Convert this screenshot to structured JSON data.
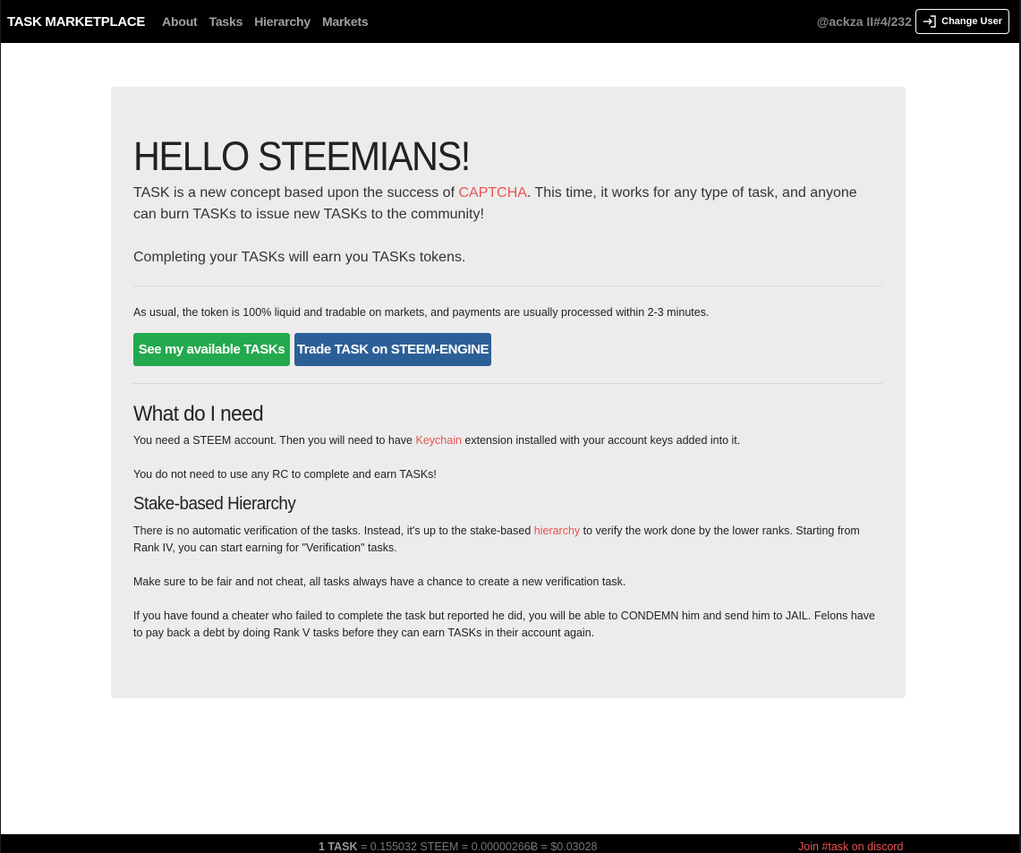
{
  "navbar": {
    "brand": "TASK MARKETPLACE",
    "links": [
      "About",
      "Tasks",
      "Hierarchy",
      "Markets"
    ],
    "user": "@ackza II#4/232",
    "change_user_label": "Change User",
    "change_user_icon": "sign-in-icon"
  },
  "hero": {
    "title": "HELLO STEEMIANS!",
    "intro_before": "TASK is a new concept based upon the success of ",
    "intro_link": "CAPTCHA",
    "intro_after": ". This time, it works for any type of task, and anyone can burn TASKs to issue new TASKs to the community!",
    "earn_text": "Completing your TASKs will earn you TASKs tokens.",
    "liquid_text": "As usual, the token is 100% liquid and tradable on markets, and payments are usually processed within 2-3 minutes.",
    "btn_tasks": "See my available TASKs",
    "btn_trade": "Trade TASK on STEEM-ENGINE"
  },
  "need": {
    "heading": "What do I need",
    "p1_before": "You need a STEEM account. Then you will need to have ",
    "p1_link": "Keychain",
    "p1_after": " extension installed with your account keys added into it.",
    "p2": "You do not need to use any RC to complete and earn TASKs!"
  },
  "hierarchy": {
    "heading": "Stake-based Hierarchy",
    "p1_before": "There is no automatic verification of the tasks. Instead, it's up to the stake-based ",
    "p1_link": "hierarchy",
    "p1_after": " to verify the work done by the lower ranks. Starting from Rank IV, you can start earning for \"Verification\" tasks.",
    "p2": "Make sure to be fair and not cheat, all tasks always have a chance to create a new verification task.",
    "p3": "If you have found a cheater who failed to complete the task but reported he did, you will be able to CONDEMN him and send him to JAIL. Felons have to pay back a debt by doing Rank V tasks before they can earn TASKs in their account again."
  },
  "footer": {
    "price_label": "1 TASK",
    "price_rest": " = 0.155032 STEEM = 0.00000266Ƀ = $0.03028",
    "discord": "Join #task on discord"
  },
  "colors": {
    "navbar_bg": "#000000",
    "card_bg": "#ececec",
    "link": "#e9534f",
    "btn_green": "#23a94d",
    "btn_blue": "#2c5f98"
  }
}
